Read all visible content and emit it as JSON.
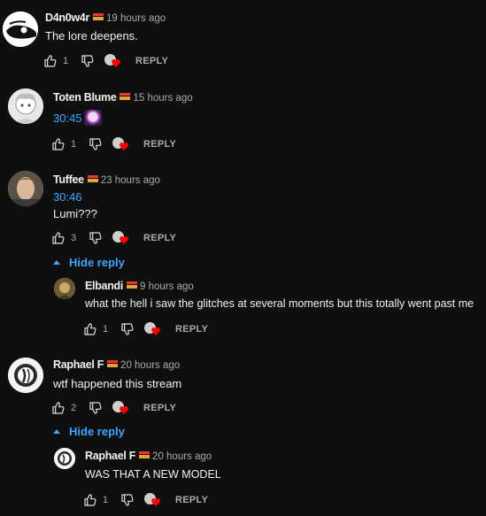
{
  "comments": [
    {
      "author": "D4n0w4r",
      "time": "19 hours ago",
      "text": "The lore deepens.",
      "likes": "1",
      "reply_label": "REPLY"
    },
    {
      "author": "Toten Blume",
      "time": "15 hours ago",
      "timestamp": "30:45",
      "likes": "1",
      "reply_label": "REPLY"
    },
    {
      "author": "Tuffee",
      "time": "23 hours ago",
      "timestamp": "30:46",
      "text": "Lumi???",
      "likes": "3",
      "reply_label": "REPLY",
      "hide_reply_label": "Hide reply",
      "reply": {
        "author": "Elbandi",
        "time": "9 hours ago",
        "text": "what the hell i saw the glitches at several moments but this totally went past me",
        "likes": "1",
        "reply_label": "REPLY"
      }
    },
    {
      "author": "Raphael F",
      "time": "20 hours ago",
      "text": "wtf happened this stream",
      "likes": "2",
      "reply_label": "REPLY",
      "hide_reply_label": "Hide reply",
      "reply": {
        "author": "Raphael F",
        "time": "20 hours ago",
        "text": "WAS THAT A NEW MODEL",
        "likes": "1",
        "reply_label": "REPLY"
      }
    }
  ],
  "colors": {
    "link": "#3ea6ff",
    "heart": "#ff0000",
    "background": "#0f0f0f"
  }
}
